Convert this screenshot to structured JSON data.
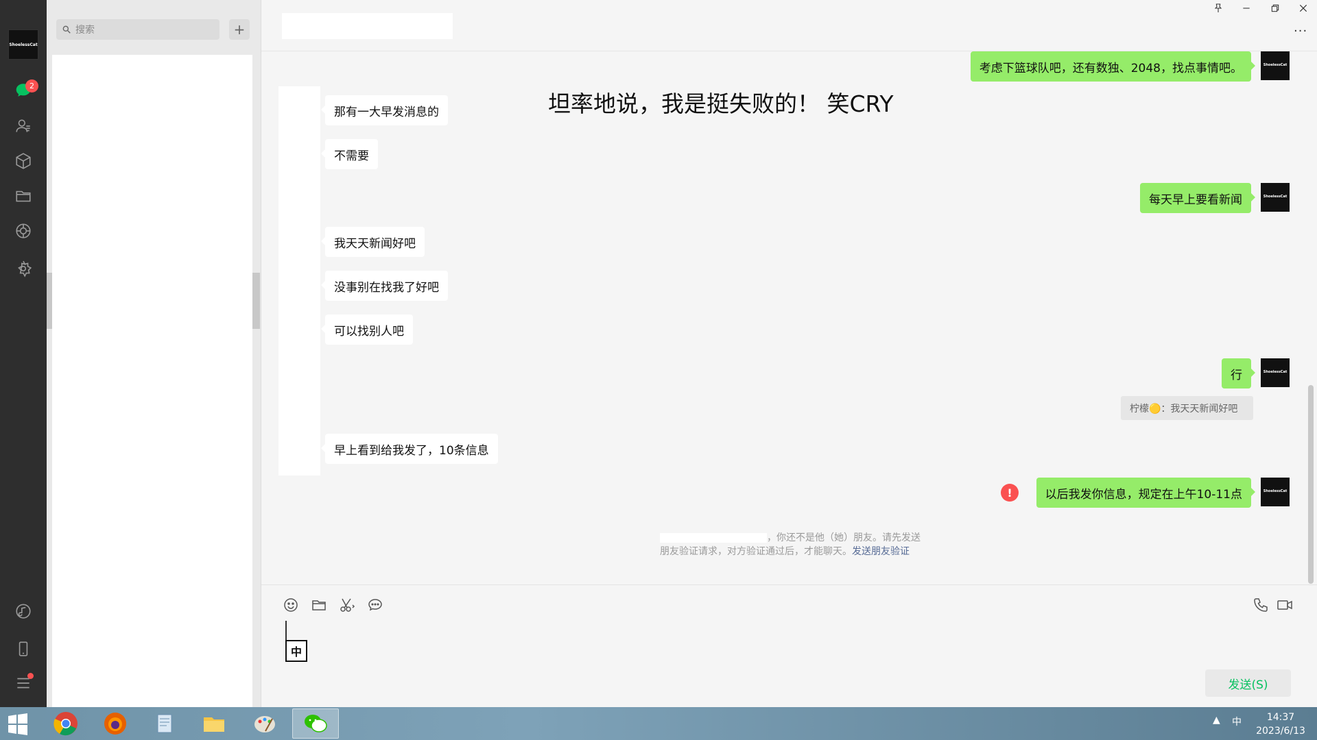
{
  "sidebar": {
    "avatar_text": "ShoelessCat",
    "unread_badge": "2",
    "icons": [
      "chat-icon",
      "contacts-icon",
      "favorites-icon",
      "folder-icon",
      "moments-icon",
      "mini-program-icon",
      "music-icon",
      "phone-icon",
      "menu-icon"
    ]
  },
  "list": {
    "search_placeholder": "搜索",
    "add_label": "+"
  },
  "header": {
    "more_label": "···"
  },
  "overlay": {
    "text": "坦率地说，我是挺失败的！ 笑CRY"
  },
  "messages": {
    "out_1": "考虑下篮球队吧，还有数独、2048，找点事情吧。",
    "in_1": "那有一大早发消息的",
    "in_2": "不需要",
    "out_2": "每天早上要看新闻",
    "in_3": "我天天新闻好吧",
    "in_4": "没事别在找我了好吧",
    "in_5": "可以找别人吧",
    "out_3": "行",
    "quote": "柠檬🟡：我天天新闻好吧",
    "in_6": "早上看到给我发了，10条信息",
    "out_4": "以后我发你信息，规定在上午10-11点",
    "error_mark": "!"
  },
  "system_note": {
    "text": "，你还不是他（她）朋友。请先发送朋友验证请求，对方验证通过后，才能聊天。",
    "link": "发送朋友验证"
  },
  "input": {
    "ime_label": "中",
    "send_label": "发送(S)"
  },
  "taskbar": {
    "ime": "中",
    "time": "14:37",
    "date": "2023/6/13"
  },
  "colors": {
    "out_bubble": "#95ec69",
    "send_text": "#07c160",
    "badge": "#fa5151",
    "link": "#576b95"
  }
}
